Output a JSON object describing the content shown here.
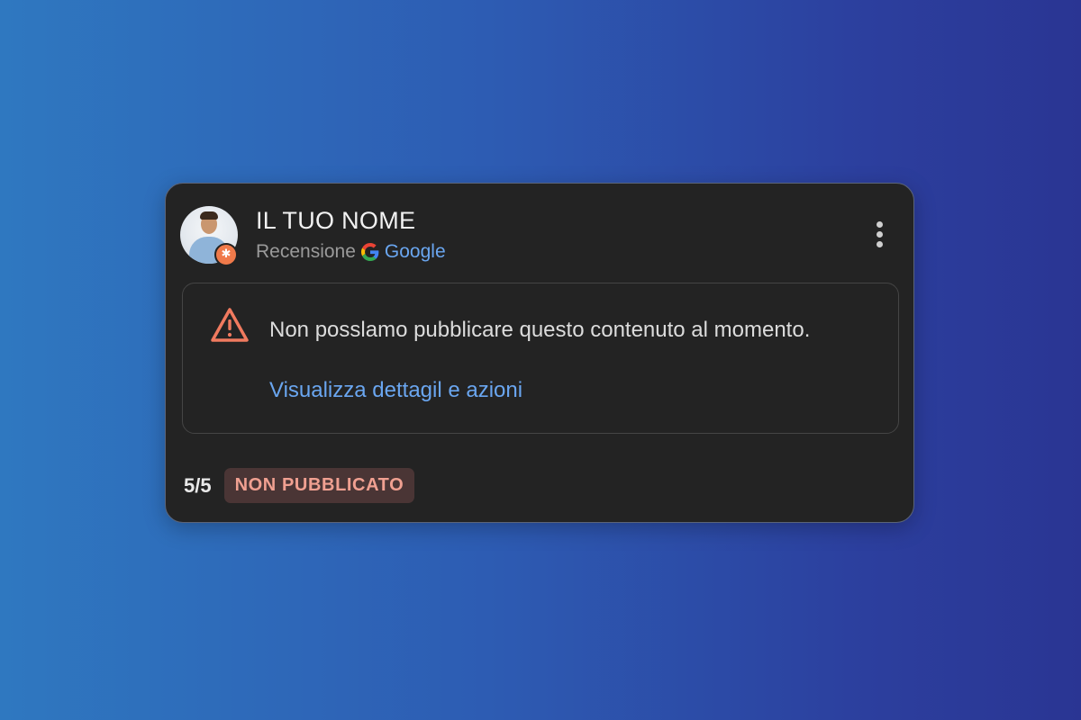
{
  "review": {
    "author_name": "IL TUO NOME",
    "subtitle_prefix": "Recensione",
    "source_name": "Google",
    "avatar_icon": "avatar-photo",
    "badge_icon": "asterisk-badge",
    "badge_glyph": "✱",
    "menu_icon": "more-vertical-icon"
  },
  "notice": {
    "icon": "warning-triangle-icon",
    "message": "Non posslamo pubblicare questo contenuto al momento.",
    "link_label": "Visualizza dettagil e azioni"
  },
  "footer": {
    "rating": "5/5",
    "status": "NON PUBBLICATO"
  },
  "colors": {
    "card_background": "#232323",
    "link": "#6aa6f0",
    "warning": "#f07a5f",
    "status_text": "#f0a091",
    "status_background": "#4a3535"
  }
}
